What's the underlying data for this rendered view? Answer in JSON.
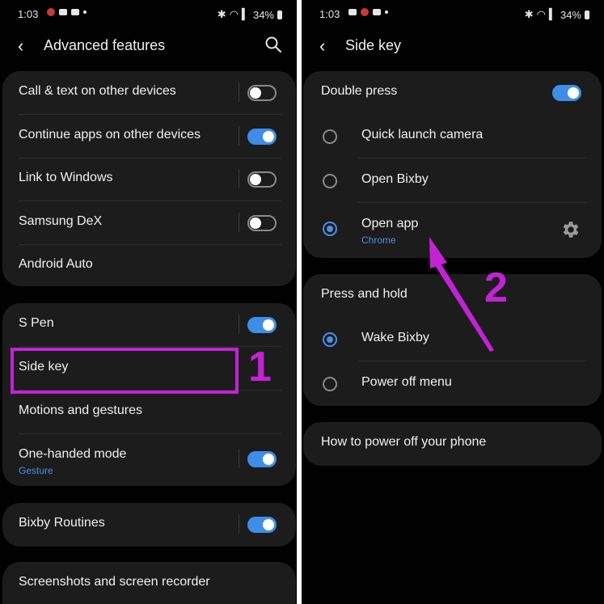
{
  "status": {
    "time": "1:03",
    "battery": "34%"
  },
  "left": {
    "title": "Advanced features",
    "group1": [
      {
        "label": "Call & text on other devices",
        "toggle": "off"
      },
      {
        "label": "Continue apps on other devices",
        "toggle": "on"
      },
      {
        "label": "Link to Windows",
        "toggle": "off"
      },
      {
        "label": "Samsung DeX",
        "toggle": "off"
      },
      {
        "label": "Android Auto"
      }
    ],
    "group2": [
      {
        "label": "S Pen",
        "toggle": "on"
      },
      {
        "label": "Side key"
      },
      {
        "label": "Motions and gestures"
      },
      {
        "label": "One-handed mode",
        "sub": "Gesture",
        "toggle": "on"
      }
    ],
    "group3": [
      {
        "label": "Bixby Routines",
        "toggle": "on"
      }
    ],
    "group4": [
      {
        "label": "Screenshots and screen recorder"
      }
    ],
    "annotation": "1"
  },
  "right": {
    "title": "Side key",
    "double_press": {
      "label": "Double press",
      "toggle": "on",
      "options": [
        {
          "label": "Quick launch camera",
          "selected": false
        },
        {
          "label": "Open Bixby",
          "selected": false
        },
        {
          "label": "Open app",
          "sub": "Chrome",
          "selected": true
        }
      ]
    },
    "press_hold": {
      "label": "Press and hold",
      "options": [
        {
          "label": "Wake Bixby",
          "selected": true
        },
        {
          "label": "Power off menu",
          "selected": false
        }
      ]
    },
    "how_to": "How to power off your phone",
    "annotation": "2"
  },
  "colors": {
    "accent": "#3e8ee9",
    "annotation": "#c322d6",
    "card": "#1c1c1c"
  }
}
